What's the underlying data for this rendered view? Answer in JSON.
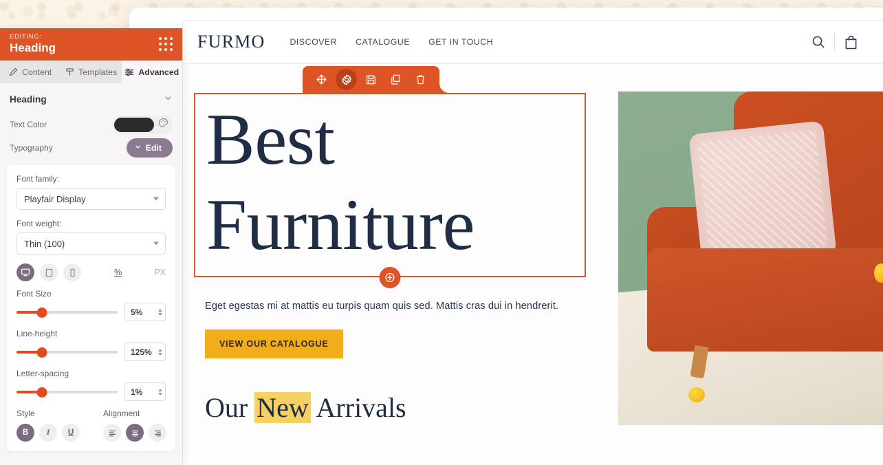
{
  "editor": {
    "panel": {
      "editing_label": "EDITING:",
      "title": "Heading",
      "grip_icon": "drag-grip-icon"
    },
    "tabs": [
      {
        "label": "Content",
        "icon": "pencil-icon",
        "active": false
      },
      {
        "label": "Templates",
        "icon": "template-icon",
        "active": false
      },
      {
        "label": "Advanced",
        "icon": "sliders-icon",
        "active": true
      }
    ],
    "section": {
      "title": "Heading",
      "chevron": "chevron-down-icon"
    },
    "text_color": {
      "label": "Text Color",
      "swatch_hex": "#2d2b2a",
      "picker_icon": "palette-icon"
    },
    "typography": {
      "label": "Typography",
      "edit_button": "Edit",
      "edit_chevron": "chevron-down-icon"
    },
    "font_family": {
      "label": "Font family:",
      "value": "Playfair Display"
    },
    "font_weight": {
      "label": "Font weight:",
      "value": "Thin (100)"
    },
    "devices": [
      {
        "name": "desktop",
        "icon": "desktop-icon",
        "active": true
      },
      {
        "name": "tablet",
        "icon": "tablet-icon",
        "active": false
      },
      {
        "name": "mobile",
        "icon": "mobile-icon",
        "active": false
      }
    ],
    "units": [
      {
        "label": "%",
        "active": true
      },
      {
        "label": "PX",
        "active": false
      }
    ],
    "controls": [
      {
        "label": "Font Size",
        "value": "5%",
        "percent": 25
      },
      {
        "label": "Line-height",
        "value": "125%",
        "percent": 25
      },
      {
        "label": "Letter-spacing",
        "value": "1%",
        "percent": 25
      }
    ],
    "style": {
      "label": "Style",
      "buttons": [
        {
          "label": "B",
          "name": "bold",
          "active": true
        },
        {
          "label": "I",
          "name": "italic",
          "active": false
        },
        {
          "label": "U",
          "name": "underline",
          "active": false
        }
      ]
    },
    "alignment": {
      "label": "Alignment",
      "buttons": [
        {
          "name": "align-left",
          "active": false
        },
        {
          "name": "align-center",
          "active": true
        },
        {
          "name": "align-right",
          "active": false
        }
      ]
    },
    "accent_hex": "#dd5427",
    "slider_hex": "#e14b1d",
    "purple_hex": "#7d6b83"
  },
  "element_toolbar": {
    "buttons": [
      {
        "name": "move-icon",
        "title": "Move",
        "active": false
      },
      {
        "name": "settings-icon",
        "title": "Settings",
        "active": true
      },
      {
        "name": "save-icon",
        "title": "Save",
        "active": false
      },
      {
        "name": "duplicate-icon",
        "title": "Duplicate",
        "active": false
      },
      {
        "name": "delete-icon",
        "title": "Delete",
        "active": false
      }
    ],
    "add_button": {
      "name": "add-element-icon",
      "title": "Add element"
    }
  },
  "site": {
    "brand": "FURMO",
    "nav": [
      "DISCOVER",
      "CATALOGUE",
      "GET IN TOUCH"
    ],
    "header_icons": [
      {
        "name": "search-icon",
        "title": "Search"
      },
      {
        "name": "bag-icon",
        "title": "Cart"
      }
    ],
    "hero": {
      "heading_line1": "Best",
      "heading_line2": "Furniture",
      "subtext": "Eget egestas mi at mattis eu turpis quam quis sed. Mattis cras dui in hendrerit.",
      "cta_label": "VIEW OUR CATALOGUE",
      "cta_hex": "#f2ad1b",
      "heading_hex": "#1f2d45",
      "photo_alt": "orange-sofa-with-pink-pillow-photo"
    },
    "lower_section": {
      "pre": "Our ",
      "highlight": "New",
      "post": " Arrivals",
      "highlight_hex": "#f6d060"
    }
  }
}
